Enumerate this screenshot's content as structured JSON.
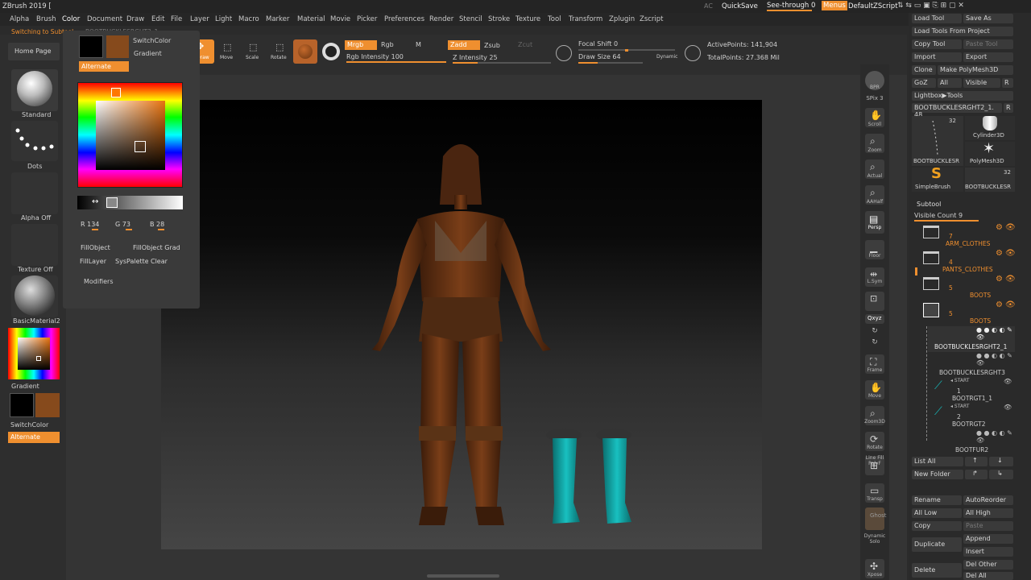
{
  "app": {
    "title": "ZBrush 2019 [",
    "notice": "Switching to Subtool",
    "notice_right": "BOOTBUCKLESRGHT2_1"
  },
  "menu": [
    "Alpha",
    "Brush",
    "Color",
    "Document",
    "Draw",
    "Edit",
    "File",
    "Layer",
    "Light",
    "Macro",
    "Marker",
    "Material",
    "Movie",
    "Picker",
    "Preferences",
    "Render",
    "Stencil",
    "Stroke",
    "Texture",
    "Tool",
    "Transform",
    "Zplugin",
    "Zscript"
  ],
  "topright": {
    "ac": "AC",
    "quicksave": "QuickSave",
    "seethrough": "See-through  0",
    "menus": "Menus",
    "script": "DefaultZScript"
  },
  "shelf": {
    "homepage": "Home Page",
    "lightbox": "Lig",
    "draw": "Draw",
    "move": "Move",
    "scale": "Scale",
    "rotate": "Rotate",
    "mrgb": "Mrgb",
    "rgb": "Rgb",
    "m": "M",
    "rgb_intensity": "Rgb Intensity 100",
    "zadd": "Zadd",
    "zsub": "Zsub",
    "zcut": "Zcut",
    "z_intensity": "Z Intensity 25",
    "focal_shift": "Focal Shift 0",
    "draw_size": "Draw Size 64",
    "dynamic": "Dynamic",
    "active_points": "ActivePoints: 141,904",
    "total_points": "TotalPoints: 27.368 Mil",
    "rgb_intensity_level": 1.0,
    "z_intensity_level": 0.25
  },
  "lefttray": {
    "standard": "Standard",
    "dots": "Dots",
    "alpha_off": "Alpha Off",
    "texture_off": "Texture Off",
    "material": "BasicMaterial2",
    "gradient": "Gradient",
    "switchcolor": "SwitchColor",
    "alternate": "Alternate",
    "main_color": "#000000",
    "secondary_color": "#864a1c"
  },
  "colorpopup": {
    "switchcolor": "SwitchColor",
    "gradient": "Gradient",
    "alternate": "Alternate",
    "r": "R 134",
    "g": "G 73",
    "b": "B 28",
    "fillobject": "FillObject",
    "fillobject_grad": "FillObject Grad",
    "filllayer": "FillLayer",
    "syspalette": "SysPalette",
    "clear": "Clear",
    "modifiers": "Modifiers",
    "active_color": "#864a1c"
  },
  "rightshelf": [
    "BPR",
    "SPix 3",
    "Scroll",
    "Zoom",
    "Actual",
    "AAHalf",
    "Persp",
    "Floor",
    "L.Sym",
    "",
    "Qxyz",
    "",
    "",
    "Frame",
    "Move",
    "Zoom3D",
    "Rotate",
    "Line Fill PolyF",
    "Transp",
    "Ghost",
    "Dynamic Solo",
    "Xpose"
  ],
  "tool": {
    "load_tool": "Load Tool",
    "save_as": "Save As",
    "load_from_project": "Load Tools From Project",
    "copy_tool": "Copy Tool",
    "paste_tool": "Paste Tool",
    "import": "Import",
    "export": "Export",
    "clone": "Clone",
    "make_polymesh": "Make PolyMesh3D",
    "goz": "GoZ",
    "all": "All",
    "visible": "Visible",
    "r": "R",
    "lightbox_tools": "Lightbox▶Tools",
    "current_tool": "BOOTBUCKLESRGHT2_1. 48",
    "r2": "R",
    "thumbs": [
      {
        "name": "BOOTBUCKLESR",
        "count": "32"
      },
      {
        "name": "Cylinder3D",
        "count": ""
      },
      {
        "name": "PolyMesh3D",
        "count": ""
      },
      {
        "name": "SimpleBrush",
        "count": ""
      },
      {
        "name": "BOOTBUCKLESR",
        "count": "32"
      }
    ]
  },
  "subtool": {
    "header": "Subtool",
    "visible_count": "Visible Count 9",
    "folders": [
      {
        "count": "7",
        "name": "ARM_CLOTHES"
      },
      {
        "count": "4",
        "name": "PANTS_CLOTHES"
      },
      {
        "count": "5",
        "name": "BOOTS"
      },
      {
        "count": "5",
        "name": "BOOTS"
      }
    ],
    "items": [
      {
        "name": "BOOTBUCKLESRGHT2_1",
        "num": ""
      },
      {
        "name": "BOOTBUCKLESRGHT3",
        "num": ""
      },
      {
        "name": "BOOTRGT1_1",
        "num": "1"
      },
      {
        "name": "BOOTRGT2",
        "num": "2"
      },
      {
        "name": "BOOTFUR2",
        "num": ""
      }
    ],
    "start": "START",
    "list_all": "List All",
    "new_folder": "New Folder",
    "rename": "Rename",
    "autoreorder": "AutoReorder",
    "all_low": "All Low",
    "all_high": "All High",
    "copy": "Copy",
    "paste": "Paste",
    "append": "Append",
    "duplicate": "Duplicate",
    "insert": "Insert",
    "delete": "Delete",
    "del_other": "Del Other",
    "del_all": "Del All"
  }
}
